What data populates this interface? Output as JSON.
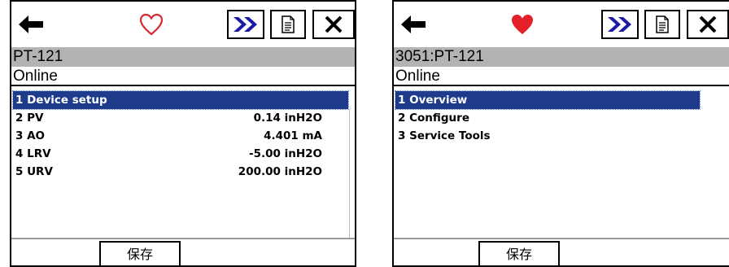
{
  "colors": {
    "selection": "#1f3c8c",
    "title_bar": "#b3b3b3",
    "heart_outline": "#d9282f",
    "heart_filled": "#e4202a",
    "chevron_blue": "#1a1aa6"
  },
  "left": {
    "title": "PT-121",
    "status": "Online",
    "menu": [
      {
        "label": "1 Device setup",
        "value": ""
      },
      {
        "label": "2 PV",
        "value": "0.14 inH2O"
      },
      {
        "label": "3 AO",
        "value": "4.401 mA"
      },
      {
        "label": "4 LRV",
        "value": "-5.00 inH2O"
      },
      {
        "label": "5 URV",
        "value": "200.00 inH2O"
      }
    ],
    "save_label": "保存",
    "icons": [
      "back-arrow-icon",
      "heart-outline-icon",
      "double-chevron-icon",
      "document-icon",
      "close-icon"
    ]
  },
  "right": {
    "title": "3051:PT-121",
    "status": "Online",
    "menu": [
      {
        "label": "1 Overview"
      },
      {
        "label": "2 Configure"
      },
      {
        "label": "3 Service Tools"
      }
    ],
    "save_label": "保存",
    "icons": [
      "back-arrow-icon",
      "heart-filled-icon",
      "double-chevron-icon",
      "document-icon",
      "close-icon"
    ]
  }
}
